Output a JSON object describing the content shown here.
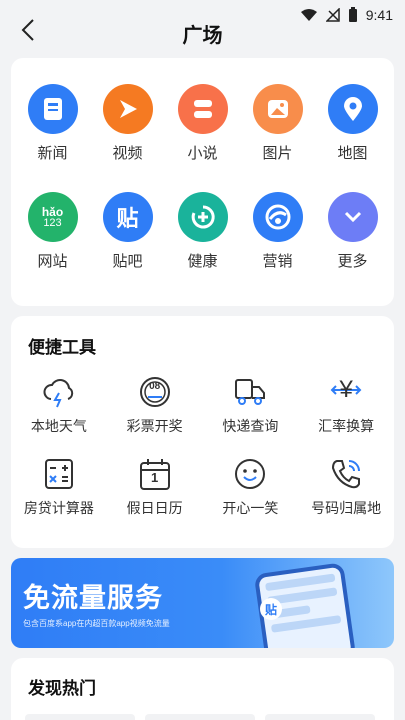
{
  "status": {
    "time": "9:41"
  },
  "header": {
    "title": "广场"
  },
  "apps": [
    {
      "label": "新闻",
      "icon": "news-icon",
      "color": "#2f7df6"
    },
    {
      "label": "视频",
      "icon": "play-icon",
      "color": "#f57a22"
    },
    {
      "label": "小说",
      "icon": "book-icon",
      "color": "#f8714a"
    },
    {
      "label": "图片",
      "icon": "image-icon",
      "color": "#f88d4b"
    },
    {
      "label": "地图",
      "icon": "location-pin-icon",
      "color": "#2f7df6"
    },
    {
      "label": "网站",
      "icon": "hao123-icon",
      "color": "#23b36b"
    },
    {
      "label": "贴吧",
      "icon": "tieba-icon",
      "color": "#2f7df6"
    },
    {
      "label": "健康",
      "icon": "health-icon",
      "color": "#1ab39b"
    },
    {
      "label": "营销",
      "icon": "marketing-icon",
      "color": "#2f7df6"
    },
    {
      "label": "更多",
      "icon": "chevron-down-icon",
      "color": "#6d7df6"
    }
  ],
  "hao123": {
    "top": "hǎo",
    "bottom": "123"
  },
  "tieba_glyph": "贴",
  "tools": {
    "title": "便捷工具",
    "items": [
      {
        "label": "本地天气",
        "icon": "weather-icon"
      },
      {
        "label": "彩票开奖",
        "icon": "lottery-icon"
      },
      {
        "label": "快递查询",
        "icon": "delivery-truck-icon"
      },
      {
        "label": "汇率换算",
        "icon": "exchange-rate-icon"
      },
      {
        "label": "房贷计算器",
        "icon": "calculator-icon"
      },
      {
        "label": "假日日历",
        "icon": "calendar-icon"
      },
      {
        "label": "开心一笑",
        "icon": "smile-icon"
      },
      {
        "label": "号码归属地",
        "icon": "phone-call-icon"
      }
    ]
  },
  "lottery_text": "08",
  "calendar_text": "1",
  "exchange_glyph": "¥",
  "banner": {
    "title": "免流量服务",
    "subtitle": "包含百度系app在内超百款app视频免流量",
    "bubble": "贴"
  },
  "hot": {
    "title": "发现热门"
  }
}
